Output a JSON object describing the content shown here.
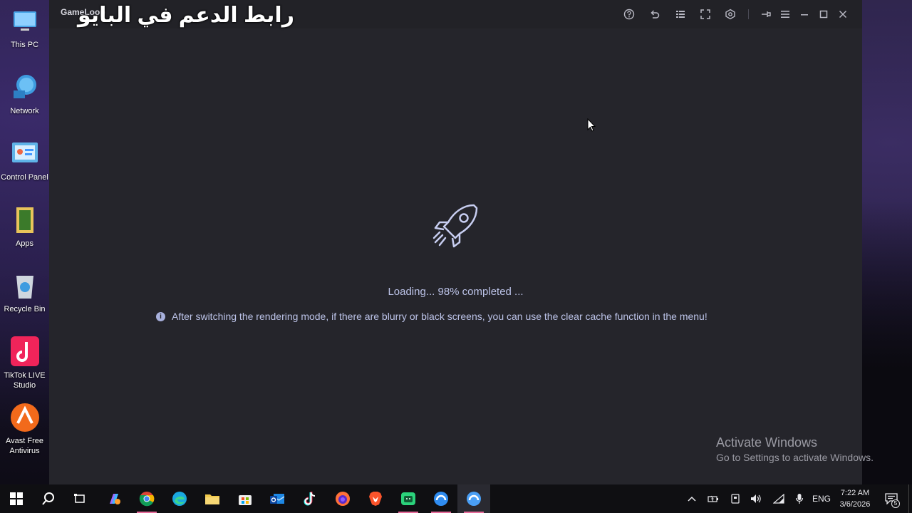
{
  "desktop": {
    "icons": [
      {
        "label": "This PC",
        "icon": "this-pc-icon"
      },
      {
        "label": "Network",
        "icon": "network-icon"
      },
      {
        "label": "Control Panel",
        "icon": "control-panel-icon"
      },
      {
        "label": "Apps",
        "icon": "apps-folder-icon"
      },
      {
        "label": "Recycle Bin",
        "icon": "recycle-bin-icon"
      },
      {
        "label": "TikTok LIVE Studio",
        "icon": "tiktok-live-icon"
      },
      {
        "label": "Avast Free Antivirus",
        "icon": "avast-icon"
      }
    ]
  },
  "window": {
    "app_name": "GameLoop",
    "overlay_caption": "رابط الدعم في البايو",
    "loading_text": "Loading... 98% completed ...",
    "hint_text": "After switching the rendering mode, if there are blurry or black screens, you can use the clear cache function in the menu!",
    "titlebar_buttons": [
      "help-icon",
      "undo-icon",
      "list-icon",
      "fullscreen-icon",
      "settings-icon",
      "pin-icon",
      "menu-icon",
      "minimize-icon",
      "maximize-icon",
      "close-icon"
    ]
  },
  "watermark": {
    "line1": "Activate Windows",
    "line2": "Go to Settings to activate Windows."
  },
  "taskbar": {
    "apps": [
      "start-icon",
      "search-icon",
      "task-view-icon",
      "copilot-icon",
      "chrome-icon",
      "edge-icon",
      "file-explorer-icon",
      "store-icon",
      "outlook-icon",
      "tiktok-icon",
      "firefox-icon",
      "brave-icon",
      "android-app-icon",
      "gameloop-icon",
      "gameloop-window-icon"
    ],
    "language": "ENG",
    "time": "7:22 AM",
    "date": "3/6/2026",
    "notification_count": "5"
  },
  "colors": {
    "window_bg": "#25252b",
    "titlebar_bg": "#222227",
    "accent_text": "#bcc3e8",
    "taskbar_bg": "#0f0f12"
  }
}
